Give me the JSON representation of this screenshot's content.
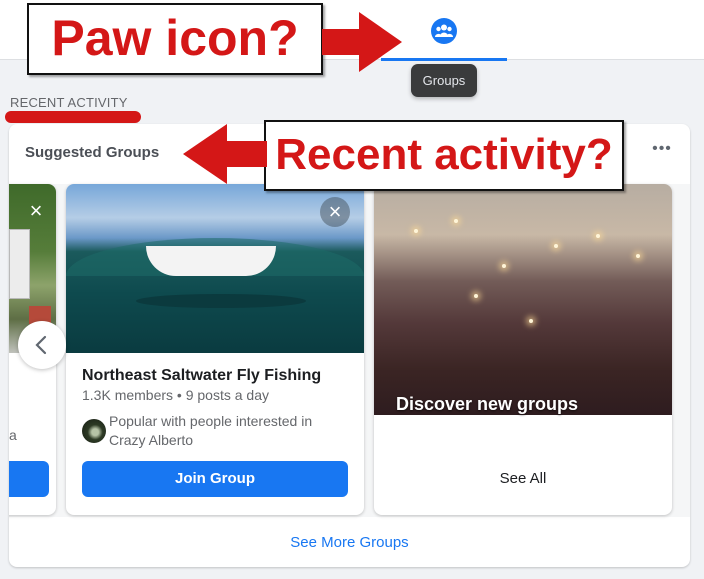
{
  "nav": {
    "active_tab": "groups",
    "tab_icon": "groups-icon",
    "tooltip": "Groups",
    "accent_color": "#1877f2"
  },
  "section": {
    "label": "RECENT ACTIVITY"
  },
  "card": {
    "title": "Suggested Groups",
    "more_label": "•••",
    "see_more_label": "See More Groups"
  },
  "carousel": {
    "prev_label": "‹",
    "partial_card": {
      "close_label": "×",
      "text_fragment": "a"
    },
    "group": {
      "name": "Northeast Saltwater Fly Fishing",
      "meta": "1.3K members • 9 posts a day",
      "social_context": "Popular with people interested in Crazy Alberto",
      "join_label": "Join Group",
      "close_label": "×"
    },
    "discover": {
      "title": "Discover new groups",
      "see_all_label": "See All"
    }
  },
  "annotations": {
    "callout_1": "Paw icon?",
    "callout_2": "Recent activity?",
    "annotation_color": "#d41717"
  }
}
